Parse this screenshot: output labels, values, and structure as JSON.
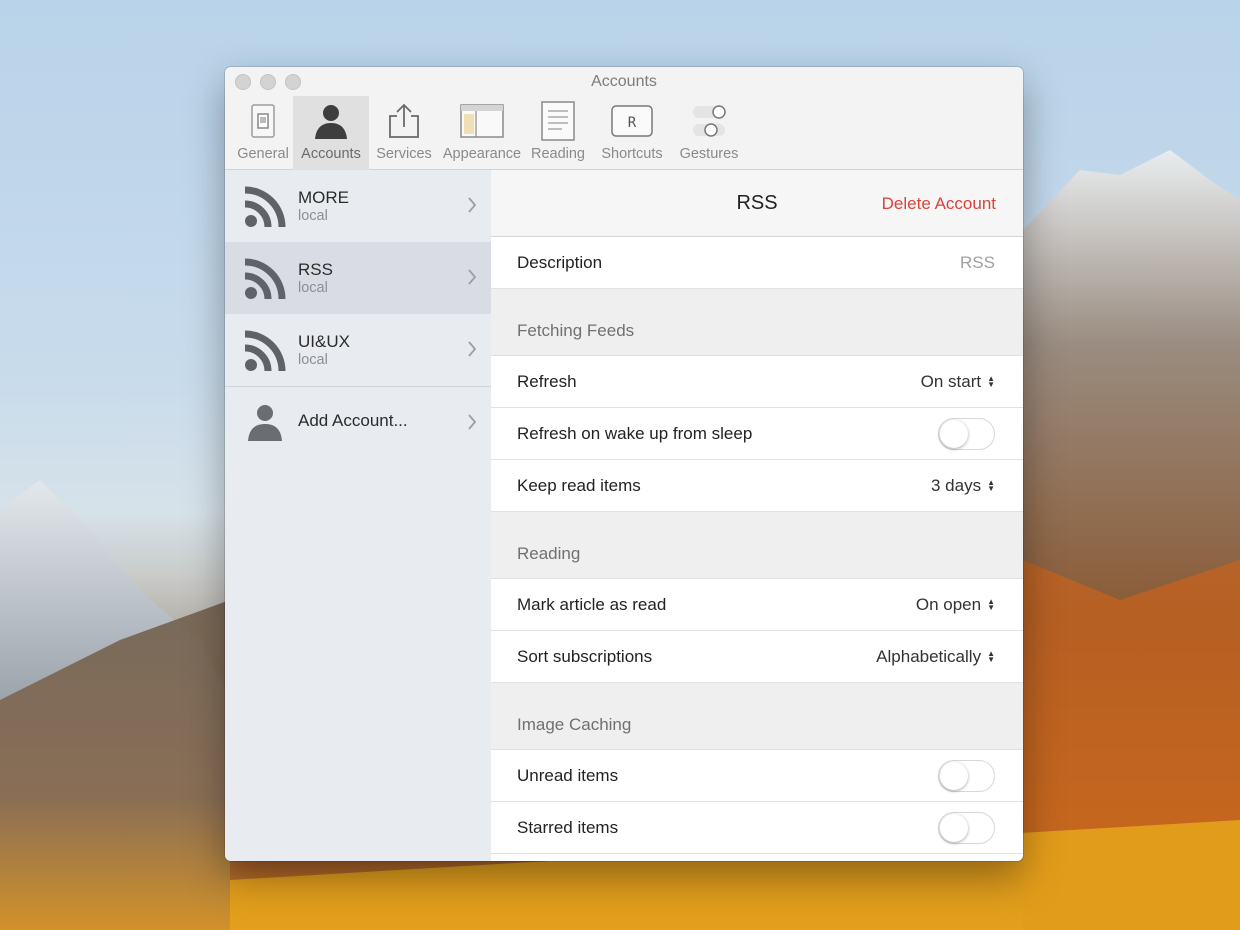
{
  "window": {
    "title": "Accounts"
  },
  "toolbar": {
    "items": [
      {
        "label": "General",
        "icon": "switch-icon"
      },
      {
        "label": "Accounts",
        "icon": "person-icon",
        "active": true
      },
      {
        "label": "Services",
        "icon": "share-icon"
      },
      {
        "label": "Appearance",
        "icon": "layout-icon"
      },
      {
        "label": "Reading",
        "icon": "document-icon"
      },
      {
        "label": "Shortcuts",
        "icon": "keyboard-key-icon",
        "key": "R"
      },
      {
        "label": "Gestures",
        "icon": "toggles-icon"
      }
    ]
  },
  "sidebar": {
    "accounts": [
      {
        "name": "MORE",
        "type": "local",
        "selected": false
      },
      {
        "name": "RSS",
        "type": "local",
        "selected": true
      },
      {
        "name": "UI&UX",
        "type": "local",
        "selected": false
      }
    ],
    "add_account_label": "Add Account..."
  },
  "content": {
    "title": "RSS",
    "delete_label": "Delete Account",
    "description": {
      "label": "Description",
      "value": "RSS"
    },
    "fetching": {
      "heading": "Fetching Feeds",
      "refresh": {
        "label": "Refresh",
        "value": "On start"
      },
      "refresh_wake": {
        "label": "Refresh on wake up from sleep",
        "on": false
      },
      "keep_read": {
        "label": "Keep read items",
        "value": "3 days"
      }
    },
    "reading": {
      "heading": "Reading",
      "mark_read": {
        "label": "Mark article as read",
        "value": "On open"
      },
      "sort": {
        "label": "Sort subscriptions",
        "value": "Alphabetically"
      }
    },
    "caching": {
      "heading": "Image Caching",
      "unread": {
        "label": "Unread items",
        "on": false
      },
      "starred": {
        "label": "Starred items",
        "on": false
      }
    }
  },
  "colors": {
    "accent_delete": "#d9433b",
    "sidebar_bg": "#e8ecf1",
    "selected_bg": "#d9dde3"
  }
}
